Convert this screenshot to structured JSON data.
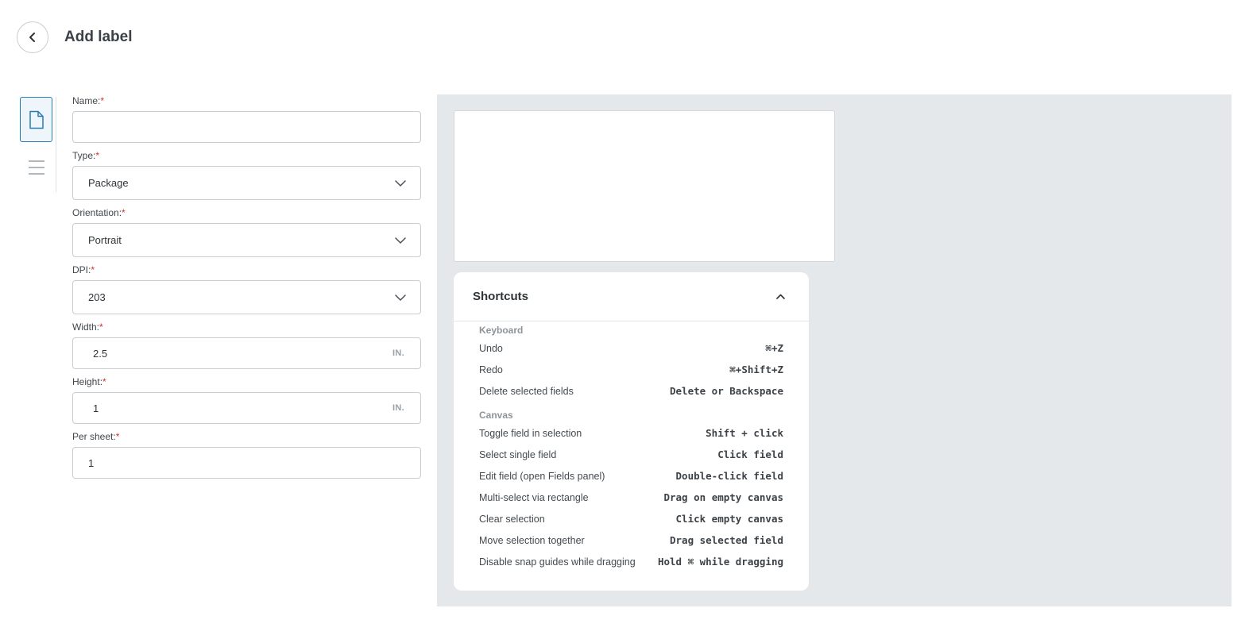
{
  "header": {
    "title": "Add label"
  },
  "form": {
    "name": {
      "label": "Name:",
      "required": "*",
      "value": ""
    },
    "type": {
      "label": "Type:",
      "required": "*",
      "value": "Package"
    },
    "orientation": {
      "label": "Orientation:",
      "required": "*",
      "value": "Portrait"
    },
    "dpi": {
      "label": "DPI:",
      "required": "*",
      "value": "203"
    },
    "width": {
      "label": "Width:",
      "required": "*",
      "value": "2.5",
      "unit": "IN."
    },
    "height": {
      "label": "Height:",
      "required": "*",
      "value": "1",
      "unit": "IN."
    },
    "per_sheet": {
      "label": "Per sheet:",
      "required": "*",
      "value": "1"
    }
  },
  "shortcuts": {
    "title": "Shortcuts",
    "keyboard_title": "Keyboard",
    "keyboard": [
      {
        "action": "Undo",
        "keys": "⌘+Z"
      },
      {
        "action": "Redo",
        "keys": "⌘+Shift+Z"
      },
      {
        "action": "Delete selected fields",
        "keys": "Delete or Backspace"
      }
    ],
    "canvas_title": "Canvas",
    "canvas": [
      {
        "action": "Toggle field in selection",
        "keys": "Shift + click"
      },
      {
        "action": "Select single field",
        "keys": "Click field"
      },
      {
        "action": "Edit field (open Fields panel)",
        "keys": "Double-click field"
      },
      {
        "action": "Multi-select via rectangle",
        "keys": "Drag on empty canvas"
      },
      {
        "action": "Clear selection",
        "keys": "Click empty canvas"
      },
      {
        "action": "Move selection together",
        "keys": "Drag selected field"
      },
      {
        "action": "Disable snap guides while dragging",
        "keys": "Hold ⌘ while dragging"
      }
    ]
  },
  "colors": {
    "accent": "#2a7ab0",
    "required": "#d0312d",
    "canvas_bg": "#e5e8eb"
  }
}
